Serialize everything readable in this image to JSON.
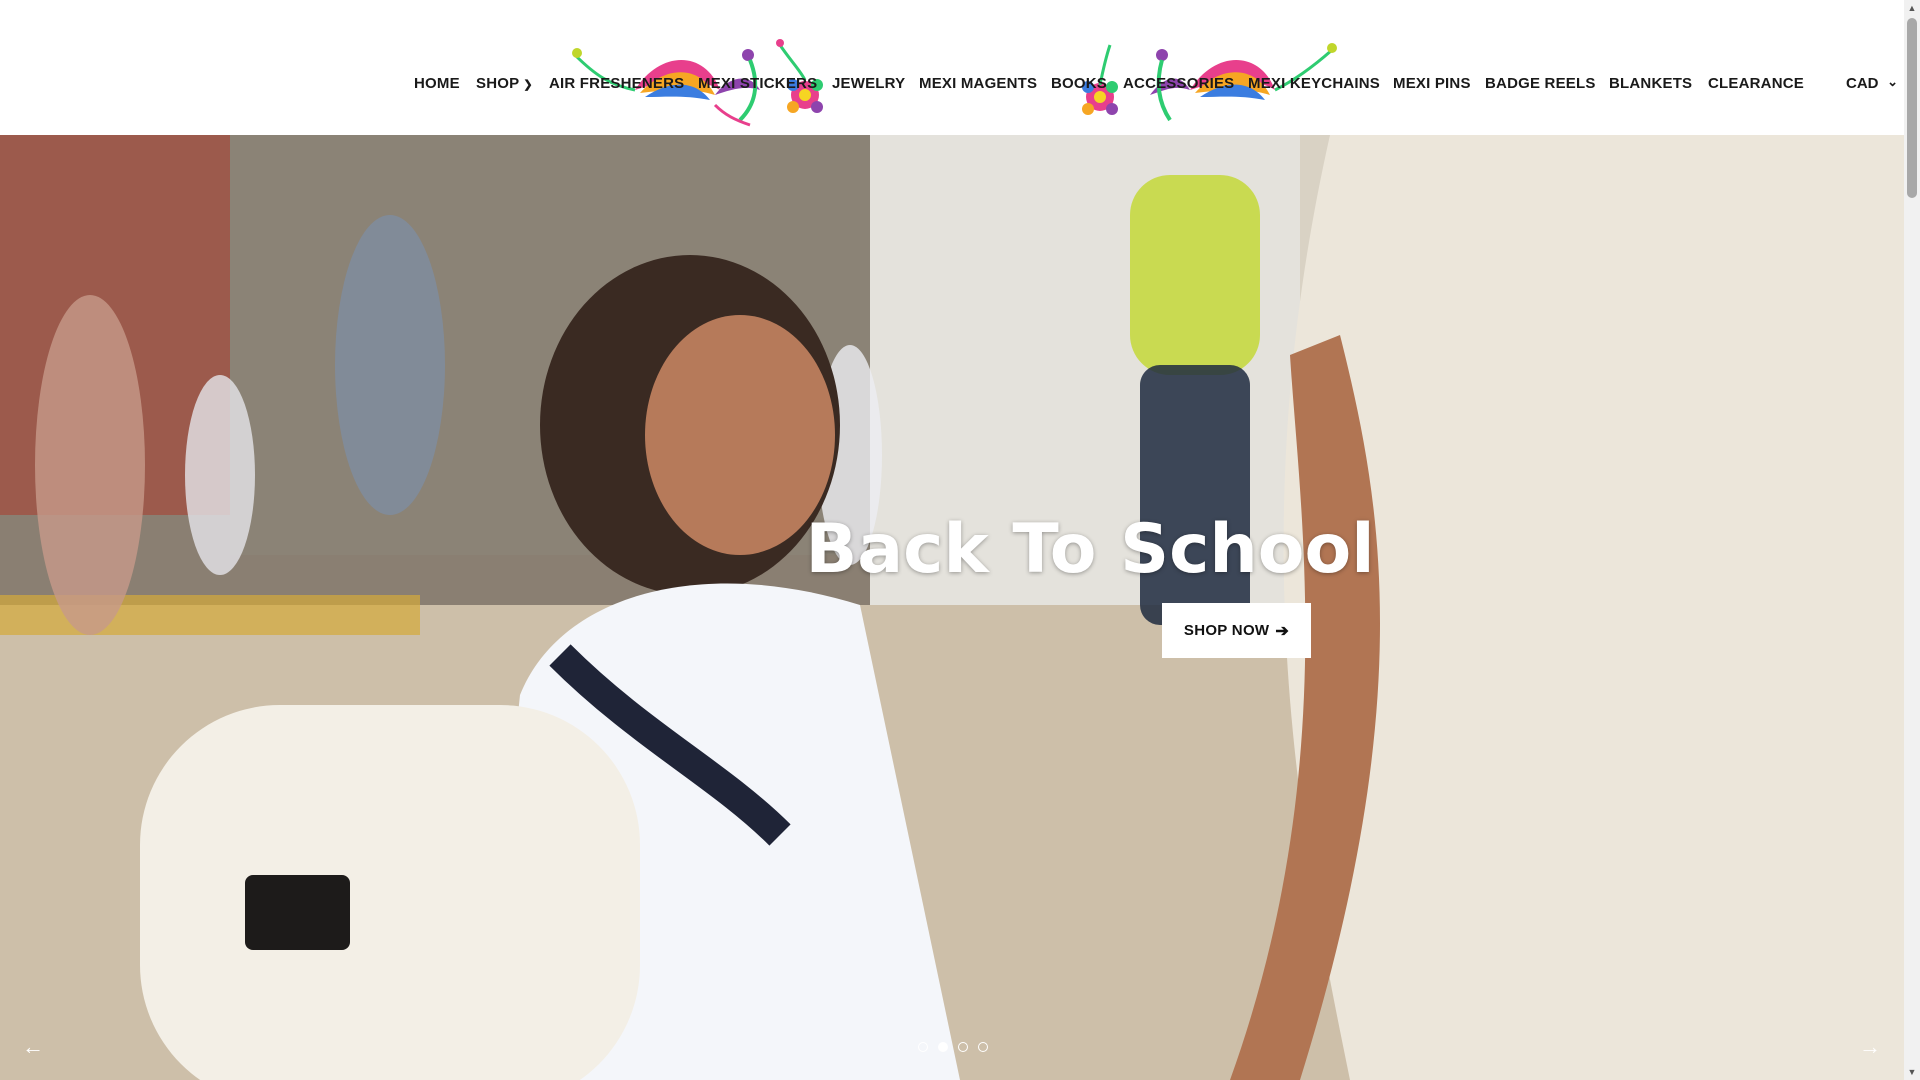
{
  "nav": {
    "items": [
      {
        "label": "HOME"
      },
      {
        "label": "SHOP",
        "has_dropdown": true
      },
      {
        "label": "AIR FRESHENERS"
      },
      {
        "label": "MEXI STICKERS"
      },
      {
        "label": "JEWELRY"
      },
      {
        "label": "MEXI MAGENTS"
      },
      {
        "label": "BOOKS"
      },
      {
        "label": "ACCESSORIES"
      },
      {
        "label": "MEXI KEYCHAINS"
      },
      {
        "label": "MEXI PINS"
      },
      {
        "label": "BADGE REELS"
      },
      {
        "label": "BLANKETS"
      },
      {
        "label": "CLEARANCE"
      }
    ],
    "dropdown_icon": "chevron-down-icon",
    "decor_icon": "otomi-bird-flower-ornament"
  },
  "currency": {
    "value": "CAD",
    "icon": "chevron-down-icon"
  },
  "hero": {
    "title": "Back To School",
    "button_label": "SHOP NOW",
    "button_icon": "arrow-right-icon",
    "prev_icon": "arrow-left-icon",
    "next_icon": "arrow-right-icon",
    "slide_count": 4,
    "active_slide": 2
  },
  "colors": {
    "nav_text": "#1a1a1a",
    "hero_text": "#ffffff",
    "button_bg": "#ffffff"
  }
}
